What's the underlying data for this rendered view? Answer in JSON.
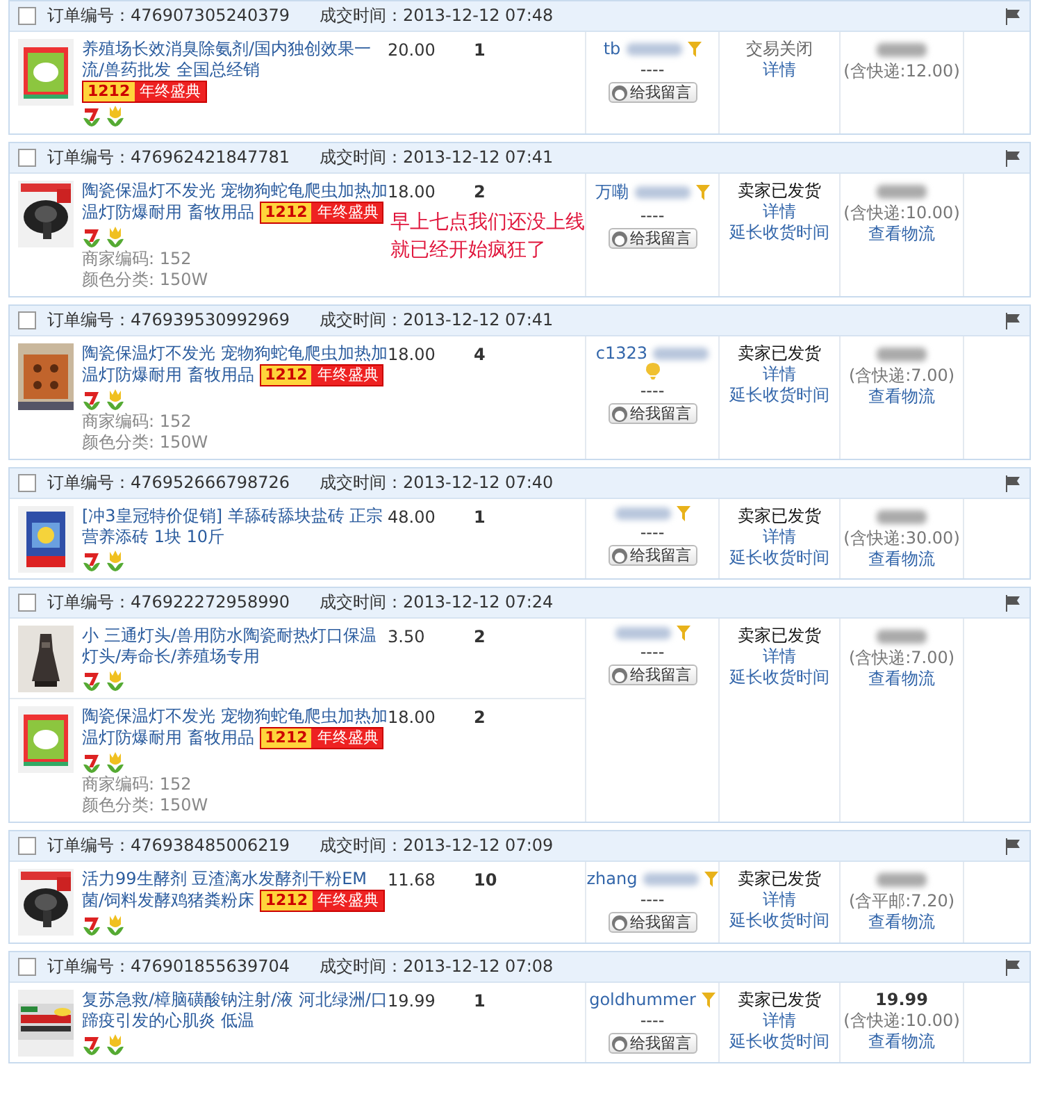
{
  "orders": [
    {
      "checked": false,
      "order_no": "订单编号：476907305240379",
      "time": "成交时间：2013-12-12 07:48",
      "items": [
        {
          "title": "养殖场长效消臭除氨剂/国内独创效果一流/兽药批发 全国总经销",
          "promo": {
            "number": "1212",
            "text": "年终盛典"
          },
          "price": "20.00",
          "qty": "1"
        }
      ],
      "buyer": "tb",
      "buyer_badge": {
        "kind": "funnel"
      },
      "dash": "----",
      "message": "给我留言",
      "kind": "closed",
      "status": "交易关闭",
      "links": [
        "详情"
      ],
      "shipping": "(含快递:12.00)"
    },
    {
      "checked": false,
      "order_no": "订单编号：476962421847781",
      "time": "成交时间：2013-12-12 07:41",
      "items": [
        {
          "title": "陶瓷保温灯不发光 宠物狗蛇龟爬虫加热加温灯防爆耐用 畜牧用品",
          "promo": {
            "number": "1212",
            "text": "年终盛典"
          },
          "price": "18.00",
          "qty": "2",
          "specs": [
            "商家编码: 152",
            "颜色分类: 150W"
          ]
        }
      ],
      "buyer": "万嘞",
      "buyer_badge": {
        "kind": "funnel"
      },
      "dash": "----",
      "message": "给我留言",
      "kind": "shipped",
      "status": "卖家已发货",
      "links": [
        "详情",
        "延长收货时间"
      ],
      "shipping": "(含快递:10.00)",
      "logistics": "查看物流"
    },
    {
      "checked": false,
      "order_no": "订单编号：476939530992969",
      "time": "成交时间：2013-12-12 07:41",
      "items": [
        {
          "title": "陶瓷保温灯不发光 宠物狗蛇龟爬虫加热加温灯防爆耐用 畜牧用品",
          "promo": {
            "number": "1212",
            "text": "年终盛典"
          },
          "price": "18.00",
          "qty": "4",
          "specs": [
            "商家编码: 152",
            "颜色分类: 150W"
          ]
        }
      ],
      "buyer": "c1323",
      "buyer_badge": {
        "kind": "bulb"
      },
      "dash": "----",
      "message": "给我留言",
      "kind": "shipped",
      "status": "卖家已发货",
      "links": [
        "详情",
        "延长收货时间"
      ],
      "shipping": "(含快递:7.00)",
      "logistics": "查看物流"
    },
    {
      "checked": false,
      "order_no": "订单编号：476952666798726",
      "time": "成交时间：2013-12-12 07:40",
      "items": [
        {
          "title": "[冲3皇冠特价促销] 羊舔砖舔块盐砖 正宗营养添砖 1块 10斤",
          "price": "48.00",
          "qty": "1"
        }
      ],
      "buyer_badge": {
        "kind": "funnel"
      },
      "dash": "----",
      "message": "给我留言",
      "kind": "shipped",
      "status": "卖家已发货",
      "links": [
        "详情",
        "延长收货时间"
      ],
      "shipping": "(含快递:30.00)",
      "logistics": "查看物流"
    },
    {
      "checked": false,
      "order_no": "订单编号：476922272958990",
      "time": "成交时间：2013-12-12 07:24",
      "items": [
        {
          "title": "小 三通灯头/兽用防水陶瓷耐热灯口保温灯头/寿命长/养殖场专用",
          "price": "3.50",
          "qty": "2"
        },
        {
          "title": "陶瓷保温灯不发光 宠物狗蛇龟爬虫加热加温灯防爆耐用 畜牧用品",
          "promo": {
            "number": "1212",
            "text": "年终盛典"
          },
          "price": "18.00",
          "qty": "2",
          "specs": [
            "商家编码: 152",
            "颜色分类: 150W"
          ]
        }
      ],
      "buyer_badge": {
        "kind": "funnel"
      },
      "dash": "----",
      "message": "给我留言",
      "kind": "shipped",
      "status": "卖家已发货",
      "links": [
        "详情",
        "延长收货时间"
      ],
      "shipping": "(含快递:7.00)",
      "logistics": "查看物流"
    },
    {
      "checked": false,
      "order_no": "订单编号：476938485006219",
      "time": "成交时间：2013-12-12 07:09",
      "items": [
        {
          "title": "活力99生酵剂 豆渣漓水发酵剂干粉EM菌/饲料发酵鸡猪粪粉床",
          "promo": {
            "number": "1212",
            "text": "年终盛典"
          },
          "price": "11.68",
          "qty": "10"
        }
      ],
      "buyer": "zhang",
      "buyer_badge": {
        "kind": "funnel"
      },
      "dash": "----",
      "message": "给我留言",
      "kind": "shipped",
      "status": "卖家已发货",
      "links": [
        "详情",
        "延长收货时间"
      ],
      "shipping": "(含平邮:7.20)",
      "logistics": "查看物流"
    },
    {
      "checked": false,
      "order_no": "订单编号：476901855639704",
      "time": "成交时间：2013-12-12 07:08",
      "items": [
        {
          "title": "复苏急救/樟脑磺酸钠注射/液 河北绿洲/口蹄疫引发的心肌炎 低温",
          "price": "19.99",
          "qty": "1"
        }
      ],
      "buyer": "goldhummer",
      "blurred": false,
      "buyer_badge": {
        "kind": "funnel"
      },
      "dash": "----",
      "message": "给我留言",
      "kind": "shipped",
      "status": "卖家已发货",
      "links": [
        "详情",
        "延长收货时间"
      ],
      "total": "19.99",
      "shipping": "(含快递:10.00)",
      "logistics": "查看物流"
    }
  ],
  "annotation": [
    "早上七点我们还没上线",
    "就已经开始疯狂了"
  ]
}
